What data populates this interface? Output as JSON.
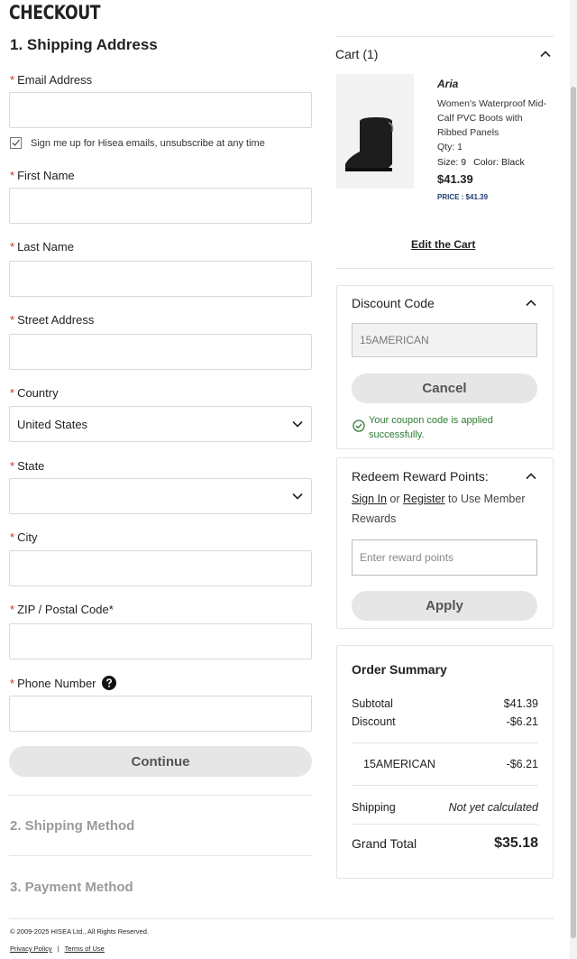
{
  "page": {
    "title": "CHECKOUT"
  },
  "shipping": {
    "heading": "1. Shipping Address",
    "email_label": "Email Address",
    "newsletter_label": "Sign me up for Hisea emails, unsubscribe at any time",
    "first_name_label": "First Name",
    "last_name_label": "Last Name",
    "street_label": "Street Address",
    "country_label": "Country",
    "country_value": "United States",
    "state_label": "State",
    "state_value": "",
    "city_label": "City",
    "zip_label": "ZIP / Postal Code*",
    "phone_label": "Phone Number",
    "continue_label": "Continue",
    "required_mark": "*"
  },
  "steps": {
    "shipping_method": "2. Shipping Method",
    "payment_method": "3. Payment Method"
  },
  "footer": {
    "copyright": "© 2009-2025 HISEA Ltd., All Rights Reserved.",
    "privacy": "Privacy Policy",
    "separator": "|",
    "terms": "Terms of Use"
  },
  "cart": {
    "heading": "Cart (1)",
    "item": {
      "brand": "Aria",
      "name": "Women's Waterproof Mid-Calf PVC Boots with Ribbed Panels",
      "qty": "Qty: 1",
      "size": "Size: 9",
      "color": "Color: Black",
      "price": "$41.39",
      "price_tag": "PRICE : $41.39"
    },
    "edit_label": "Edit the Cart"
  },
  "discount": {
    "heading": "Discount Code",
    "code_value": "15AMERICAN",
    "cancel_label": "Cancel",
    "success_msg": "Your coupon code is applied successfully."
  },
  "reward": {
    "heading": "Redeem Reward Points:",
    "sign_in": "Sign In",
    "or": "or",
    "register": "Register",
    "rest": "to Use Member Rewards",
    "placeholder": "Enter reward points",
    "apply_label": "Apply"
  },
  "summary": {
    "heading": "Order Summary",
    "subtotal_label": "Subtotal",
    "subtotal_value": "$41.39",
    "discount_label": "Discount",
    "discount_value": "-$6.21",
    "code_label": "15AMERICAN",
    "code_value": "-$6.21",
    "shipping_label": "Shipping",
    "shipping_value": "Not yet calculated",
    "grand_label": "Grand Total",
    "grand_value": "$35.18"
  },
  "colors": {
    "required": "#d32f2f",
    "success": "#2e7d32",
    "price_tag": "#1f3a70"
  }
}
